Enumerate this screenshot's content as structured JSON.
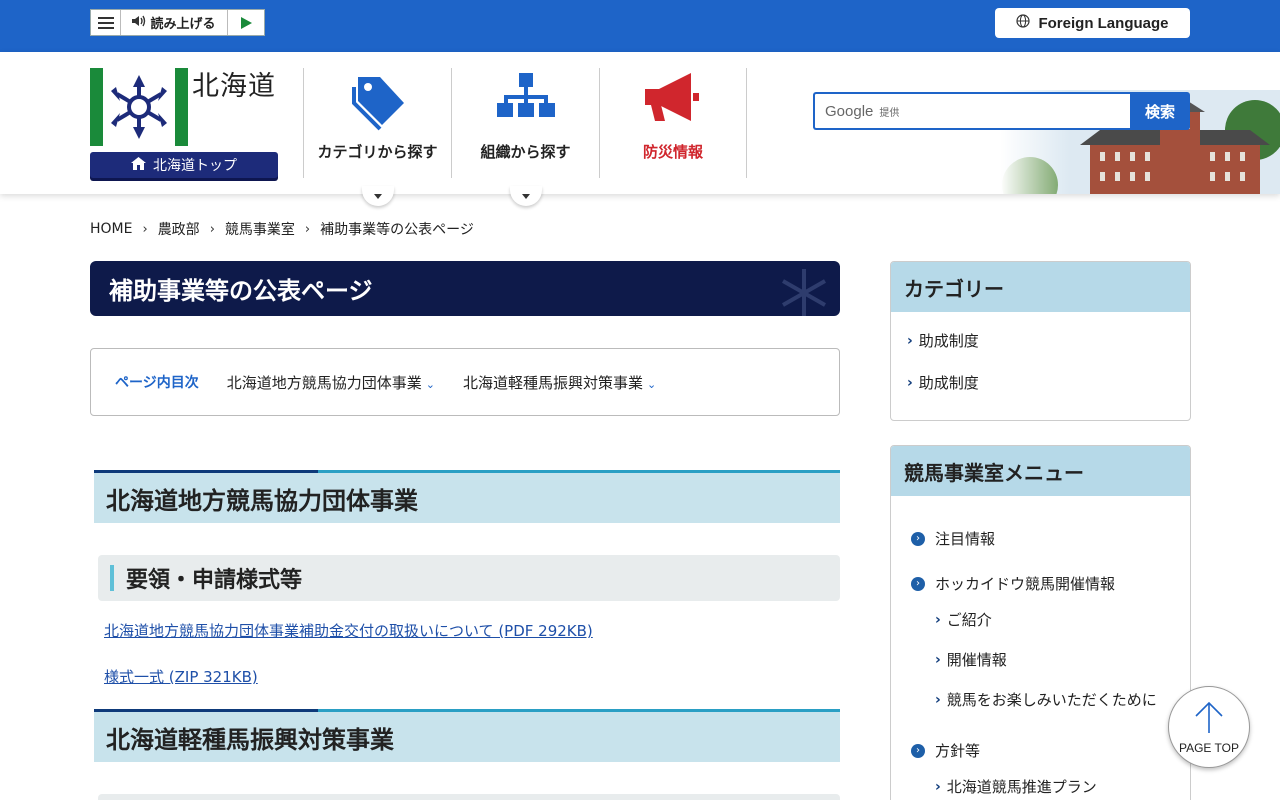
{
  "utility": {
    "read_aloud": "読み上げる",
    "foreign_language": "Foreign Language"
  },
  "header": {
    "logo_text": "北海道",
    "top_link": "北海道トップ",
    "nav": [
      {
        "label": "カテゴリから探す",
        "icon": "tag-icon",
        "color": "#1e64c8"
      },
      {
        "label": "組織から探す",
        "icon": "org-chart-icon",
        "color": "#1e64c8"
      },
      {
        "label": "防災情報",
        "icon": "megaphone-icon",
        "color": "#d0262d"
      }
    ],
    "search": {
      "brand": "Google",
      "provided": "提供",
      "button": "検索"
    }
  },
  "breadcrumb": [
    "HOME",
    "農政部",
    "競馬事業室",
    "補助事業等の公表ページ"
  ],
  "main": {
    "title": "補助事業等の公表ページ",
    "toc": {
      "label": "ページ内目次",
      "items": [
        "北海道地方競馬協力団体事業",
        "北海道軽種馬振興対策事業"
      ]
    },
    "sections": [
      {
        "heading": "北海道地方競馬協力団体事業",
        "subheading": "要領・申請様式等",
        "links": [
          "北海道地方競馬協力団体事業補助金交付の取扱いについて (PDF 292KB)",
          "様式一式 (ZIP 321KB)"
        ]
      },
      {
        "heading": "北海道軽種馬振興対策事業"
      }
    ]
  },
  "sidebar": {
    "category": {
      "title": "カテゴリー",
      "items": [
        "助成制度",
        "助成制度"
      ]
    },
    "menu": {
      "title": "競馬事業室メニュー",
      "items": [
        {
          "label": "注目情報",
          "level": 1
        },
        {
          "label": "ホッカイドウ競馬開催情報",
          "level": 1
        },
        {
          "label": "ご紹介",
          "level": 2
        },
        {
          "label": "開催情報",
          "level": 2
        },
        {
          "label": "競馬をお楽しみいただくために",
          "level": 2
        },
        {
          "label": "方針等",
          "level": 1
        },
        {
          "label": "北海道競馬推進プラン",
          "level": 2
        }
      ]
    }
  },
  "page_top": "PAGE TOP",
  "colors": {
    "brand_blue": "#1e64c8",
    "navy": "#0e1a4a",
    "alert_red": "#d0262d"
  }
}
